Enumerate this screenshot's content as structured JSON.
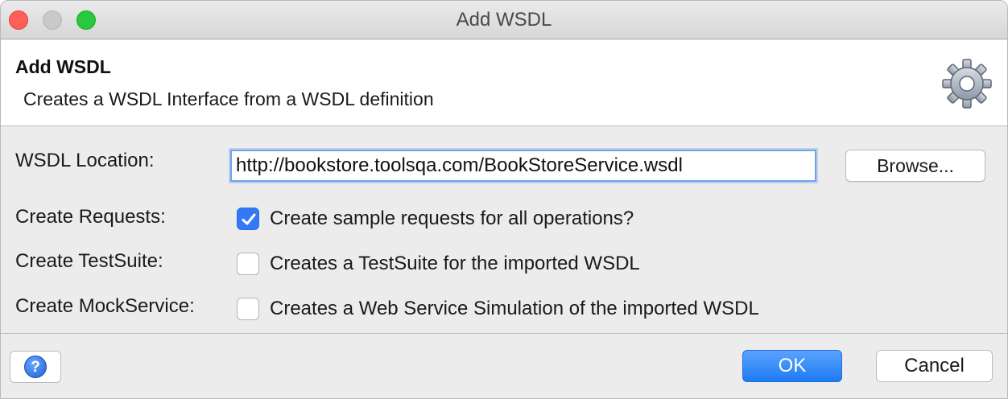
{
  "window": {
    "title": "Add WSDL"
  },
  "header": {
    "title": "Add WSDL",
    "description": "Creates a WSDL Interface from a WSDL definition",
    "icon": "gear-icon"
  },
  "form": {
    "wsdl_location_label": "WSDL Location:",
    "wsdl_location_value": "http://bookstore.toolsqa.com/BookStoreService.wsdl",
    "browse_label": "Browse...",
    "options": [
      {
        "label": "Create Requests:",
        "text": "Create sample requests for all operations?",
        "checked": true
      },
      {
        "label": "Create TestSuite:",
        "text": "Creates a TestSuite for the imported WSDL",
        "checked": false
      },
      {
        "label": "Create MockService:",
        "text": "Creates a Web Service Simulation of the imported WSDL",
        "checked": false
      }
    ]
  },
  "footer": {
    "help_glyph": "?",
    "ok_label": "OK",
    "cancel_label": "Cancel"
  },
  "colors": {
    "accent": "#3478f6",
    "close": "#fe5f57",
    "minimize": "#c9c9c9",
    "maximize": "#2ac840"
  }
}
